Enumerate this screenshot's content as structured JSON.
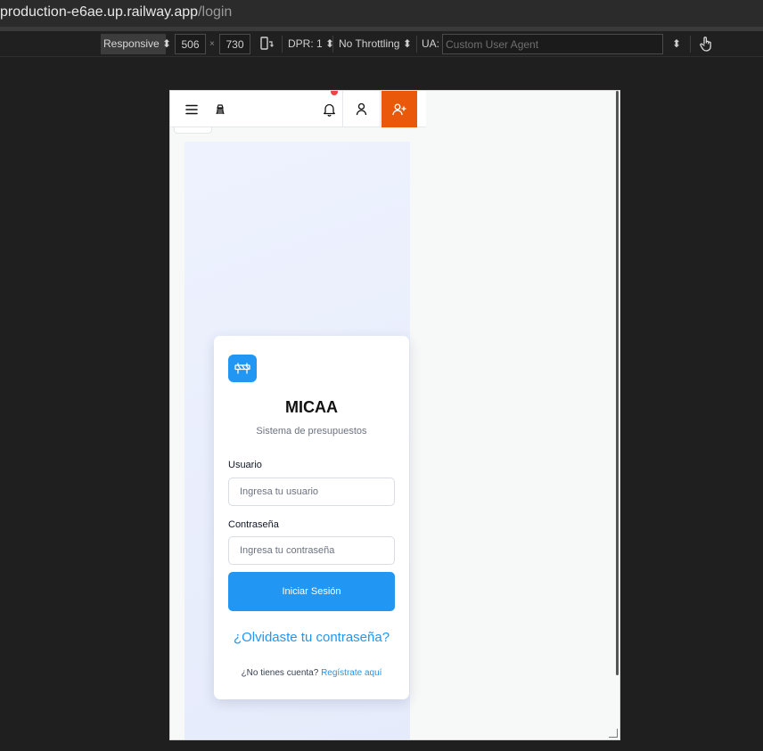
{
  "browser": {
    "url_host": "production-e6ae.up.railway.app",
    "url_path": "/login"
  },
  "devtools": {
    "device_mode": "Responsive",
    "width_value": "506",
    "times_sign": "×",
    "height_value": "730",
    "dpr_label": "DPR: 1",
    "throttling_label": "No Throttling",
    "ua_label": "UA:",
    "ua_placeholder": "Custom User Agent"
  },
  "app": {
    "colors": {
      "primary": "#2196f3",
      "register_button": "#ea580c",
      "notification_dot": "#ef4444"
    },
    "header": {
      "menu_icon": "hamburger-icon",
      "logo_icon": "excavator-icon",
      "notifications_icon": "bell-icon",
      "account_icon": "user-icon",
      "register_icon": "user-plus-icon"
    },
    "login": {
      "logo_icon": "barrier-icon",
      "title": "MICAA",
      "subtitle": "Sistema de presupuestos",
      "username_label": "Usuario",
      "username_placeholder": "Ingresa tu usuario",
      "password_label": "Contraseña",
      "password_placeholder": "Ingresa tu contraseña",
      "submit_label": "Iniciar Sesión",
      "forgot_link": "¿Olvidaste tu contraseña?",
      "no_account_text": "¿No tienes cuenta?",
      "register_link": "Regístrate aquí"
    }
  }
}
